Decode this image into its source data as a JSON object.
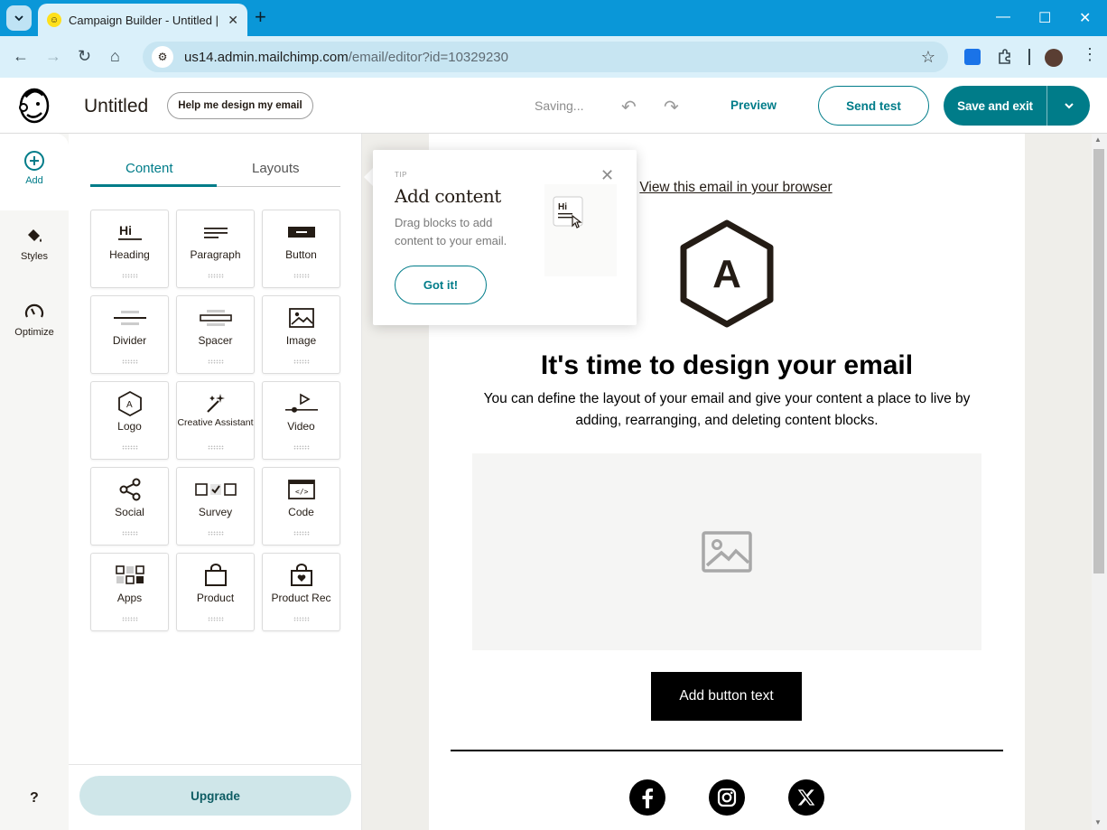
{
  "browser": {
    "tab_title": "Campaign Builder - Untitled | ",
    "url_host": "us14.admin.mailchimp.com",
    "url_path": "/email/editor?id=10329230"
  },
  "header": {
    "doc_title": "Untitled",
    "help_label": "Help me design my email",
    "status": "Saving...",
    "preview_label": "Preview",
    "send_test_label": "Send test",
    "save_exit_label": "Save and exit"
  },
  "rail": {
    "items": [
      {
        "label": "Add",
        "icon": "add-circle-icon"
      },
      {
        "label": "Styles",
        "icon": "paint-bucket-icon"
      },
      {
        "label": "Optimize",
        "icon": "gauge-icon"
      }
    ],
    "help": "?"
  },
  "panel": {
    "tabs": [
      "Content",
      "Layouts"
    ],
    "active_tab": "Content",
    "blocks": [
      {
        "label": "Heading",
        "icon": "heading-icon"
      },
      {
        "label": "Paragraph",
        "icon": "paragraph-icon"
      },
      {
        "label": "Button",
        "icon": "button-icon"
      },
      {
        "label": "Divider",
        "icon": "divider-icon"
      },
      {
        "label": "Spacer",
        "icon": "spacer-icon"
      },
      {
        "label": "Image",
        "icon": "image-icon"
      },
      {
        "label": "Logo",
        "icon": "logo-icon"
      },
      {
        "label": "Creative Assistant",
        "icon": "magic-wand-icon"
      },
      {
        "label": "Video",
        "icon": "video-icon"
      },
      {
        "label": "Social",
        "icon": "share-icon"
      },
      {
        "label": "Survey",
        "icon": "survey-icon"
      },
      {
        "label": "Code",
        "icon": "code-icon"
      },
      {
        "label": "Apps",
        "icon": "apps-icon"
      },
      {
        "label": "Product",
        "icon": "shopping-bag-icon"
      },
      {
        "label": "Product Rec",
        "icon": "product-rec-icon"
      }
    ],
    "upgrade_label": "Upgrade"
  },
  "tip": {
    "label": "TIP",
    "title": "Add content",
    "body": "Drag blocks to add content to your email.",
    "button": "Got it!"
  },
  "email": {
    "view_link": "View this email in your browser",
    "logo_letter": "A",
    "headline": "It's time to design your email",
    "body": "You can define the layout of your email and give your content a place to live by adding, rearranging, and deleting content blocks.",
    "button_text": "Add button text",
    "social": [
      "facebook-icon",
      "instagram-icon",
      "x-icon"
    ]
  },
  "colors": {
    "brand": "#007c89",
    "chrome": "#0a97d8",
    "canvas": "#efeeea"
  }
}
